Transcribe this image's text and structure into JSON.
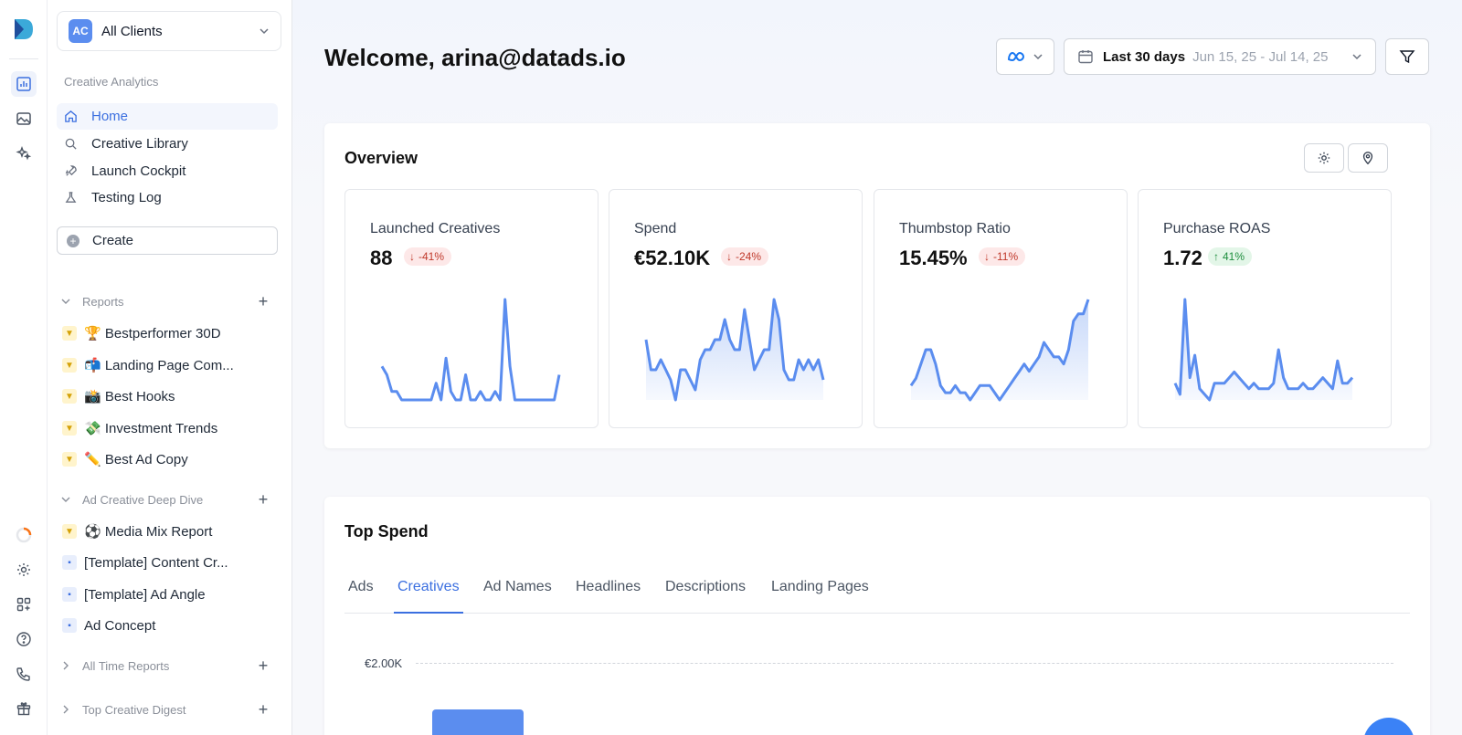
{
  "client": {
    "avatar": "AC",
    "name": "All Clients"
  },
  "sidebar": {
    "section_label": "Creative Analytics",
    "nav": [
      {
        "label": "Home",
        "icon": "home-icon",
        "active": true
      },
      {
        "label": "Creative Library",
        "icon": "search-icon"
      },
      {
        "label": "Launch Cockpit",
        "icon": "rocket-icon"
      },
      {
        "label": "Testing Log",
        "icon": "flask-icon"
      }
    ],
    "create_label": "Create",
    "groups": [
      {
        "label": "Reports",
        "items": [
          {
            "label": "🏆 Bestperformer 30D",
            "icon": "trophy-icon"
          },
          {
            "label": "📬 Landing Page Com...",
            "icon": "trophy-icon"
          },
          {
            "label": "📸 Best Hooks",
            "icon": "trophy-icon"
          },
          {
            "label": "💸 Investment Trends",
            "icon": "trophy-icon"
          },
          {
            "label": "✏️ Best Ad Copy",
            "icon": "trophy-icon"
          }
        ]
      },
      {
        "label": "Ad Creative Deep Dive",
        "items": [
          {
            "label": "⚽ Media Mix Report",
            "icon": "trophy-icon"
          },
          {
            "label": "[Template] Content Cr...",
            "icon": "template-icon"
          },
          {
            "label": "[Template] Ad Angle",
            "icon": "template-icon"
          },
          {
            "label": "Ad Concept",
            "icon": "template-icon"
          }
        ]
      },
      {
        "label": "All Time Reports",
        "items": []
      },
      {
        "label": "Top Creative Digest",
        "items": []
      }
    ]
  },
  "header": {
    "welcome": "Welcome, arina@datads.io",
    "date_label": "Last 30 days",
    "date_range": "Jun 15, 25 - Jul 14, 25"
  },
  "overview": {
    "title": "Overview",
    "kpis": [
      {
        "label": "Launched Creatives",
        "value": "88",
        "change": "-41%",
        "direction": "down",
        "series": [
          4,
          3,
          1,
          1,
          0,
          0,
          0,
          0,
          0,
          0,
          0,
          2,
          0,
          5,
          1,
          0,
          0,
          3,
          0,
          0,
          1,
          0,
          0,
          1,
          0,
          12,
          4,
          0,
          0,
          0,
          0,
          0,
          0,
          0,
          0,
          0,
          3
        ]
      },
      {
        "label": "Spend",
        "value": "€52.10K",
        "change": "-24%",
        "direction": "down",
        "series": [
          9,
          6,
          6,
          7,
          6,
          5,
          3,
          6,
          6,
          5,
          4,
          7,
          8,
          8,
          9,
          9,
          11,
          9,
          8,
          8,
          12,
          9,
          6,
          7,
          8,
          8,
          13,
          11,
          6,
          5,
          5,
          7,
          6,
          7,
          6,
          7,
          5
        ]
      },
      {
        "label": "Thumbstop Ratio",
        "value": "15.45%",
        "change": "-11%",
        "direction": "down",
        "series": [
          4,
          5,
          7,
          9,
          9,
          7,
          4,
          3,
          3,
          4,
          3,
          3,
          2,
          3,
          4,
          4,
          4,
          3,
          2,
          3,
          4,
          5,
          6,
          7,
          6,
          7,
          8,
          10,
          9,
          8,
          8,
          7,
          9,
          13,
          14,
          14,
          16
        ]
      },
      {
        "label": "Purchase ROAS",
        "value": "1.72",
        "change": "41%",
        "direction": "up",
        "series": [
          3,
          1,
          18,
          4,
          8,
          2,
          1,
          0,
          3,
          3,
          3,
          4,
          5,
          4,
          3,
          2,
          3,
          2,
          2,
          2,
          3,
          9,
          4,
          2,
          2,
          2,
          3,
          2,
          2,
          3,
          4,
          3,
          2,
          7,
          3,
          3,
          4
        ]
      }
    ]
  },
  "top_spend": {
    "title": "Top Spend",
    "tabs": [
      "Ads",
      "Creatives",
      "Ad Names",
      "Headlines",
      "Descriptions",
      "Landing Pages"
    ],
    "active_tab": "Creatives",
    "y_tick": "€2.00K"
  },
  "colors": {
    "accent": "#3b6fe0",
    "spark_line": "#5b8def",
    "spark_fill": "#dce6fb"
  }
}
